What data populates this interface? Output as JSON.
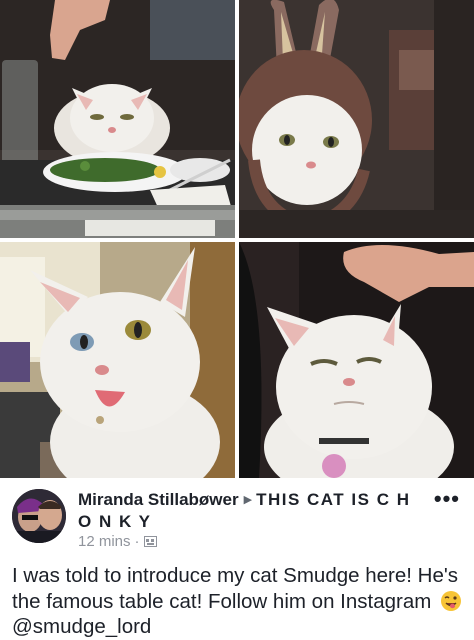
{
  "images": [
    {
      "name": "photo-cat-at-dinner-table"
    },
    {
      "name": "photo-cat-in-bunny-hat"
    },
    {
      "name": "photo-cat-with-tongue-out"
    },
    {
      "name": "photo-cat-being-petted"
    }
  ],
  "post": {
    "author": "Miranda Stillabøwer",
    "arrow": "▶",
    "group": "THIS CAT IS C H O N K Y",
    "time": "12 mins",
    "more_label": "•••",
    "text": "I was told to introduce my cat Smudge here! He's the famous table cat! Follow him on Instagram ",
    "handle": "@smudge_lord",
    "emoji_icon": "winking-tongue-emoji-icon"
  },
  "colors": {
    "text": "#1d2129",
    "meta": "#90949c",
    "cat_white": "#f2f0ec",
    "nose_pink": "#d98a8c"
  }
}
